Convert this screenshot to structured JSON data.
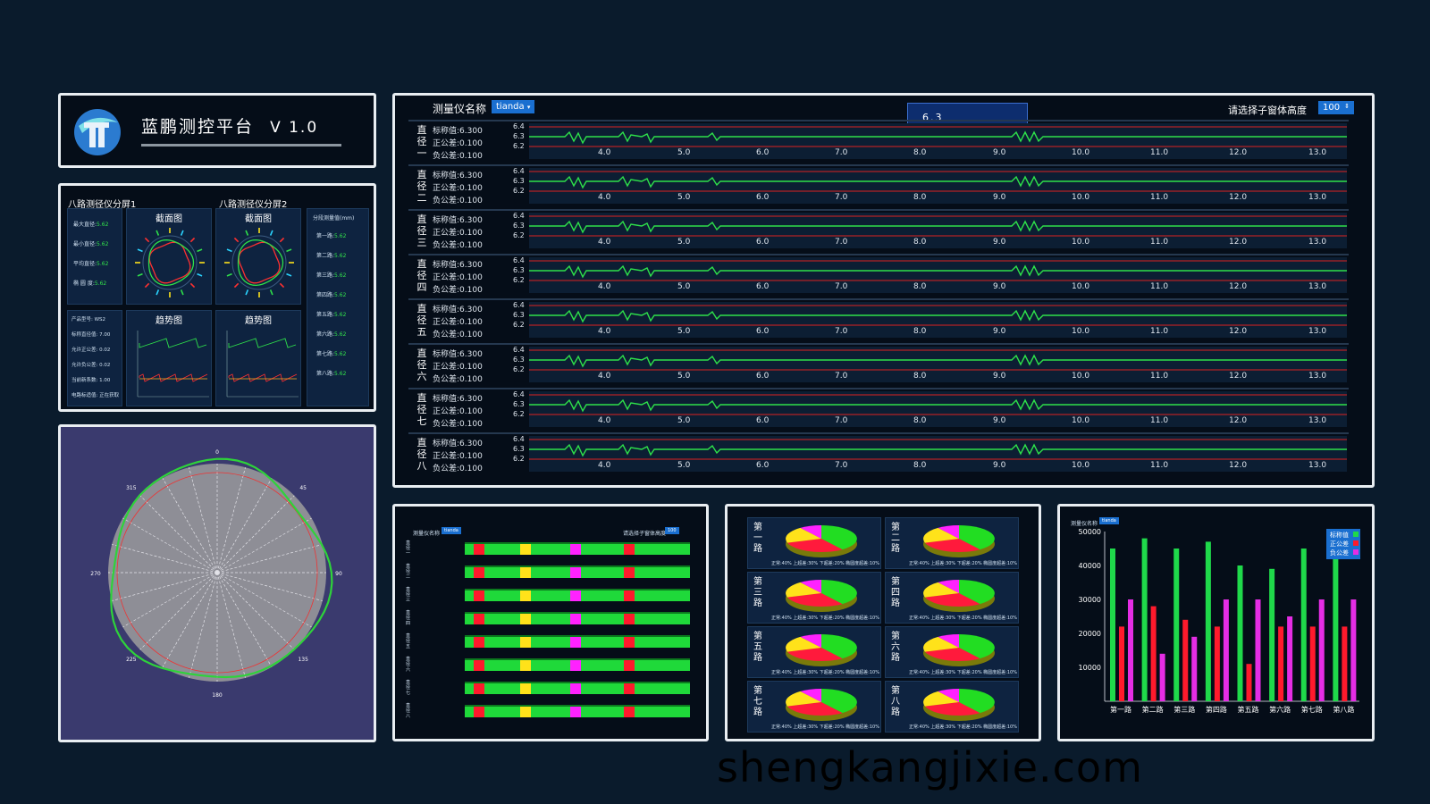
{
  "header": {
    "title": "蓝鹏测控平台",
    "version": "V 1.0"
  },
  "eight_channel": {
    "screen1_title": "八路测径仪分屏1",
    "screen2_title": "八路测径仪分屏2",
    "section_label": "截面图",
    "trend_label": "趋势图",
    "stats": [
      {
        "label": "最大直径:",
        "value": "5.62"
      },
      {
        "label": "最小直径:",
        "value": "5.62"
      },
      {
        "label": "平均直径:",
        "value": "5.62"
      },
      {
        "label": "椭 圆 度:",
        "value": "5.62"
      }
    ],
    "product_info": [
      "产品型号: WS2",
      "标称直径值: 7.00",
      "允许正公差: 0.02",
      "允许负公差: 0.02",
      "当前新系数: 1.00",
      "电路标适值: 正在获取"
    ],
    "measure_title": "分段测量值(mm)",
    "measures": [
      {
        "label": "第一路:",
        "value": "5.62"
      },
      {
        "label": "第二路:",
        "value": "5.62"
      },
      {
        "label": "第三路:",
        "value": "5.62"
      },
      {
        "label": "第四路:",
        "value": "5.62"
      },
      {
        "label": "第五路:",
        "value": "5.62"
      },
      {
        "label": "第六路:",
        "value": "5.62"
      },
      {
        "label": "第七路:",
        "value": "5.62"
      },
      {
        "label": "第八路:",
        "value": "5.62"
      }
    ]
  },
  "polar": {
    "angle_labels": [
      "0",
      "45",
      "90",
      "135",
      "180",
      "225",
      "270",
      "315"
    ]
  },
  "main": {
    "instrument_label": "测量仪名称",
    "instrument_value": "tianda",
    "height_label": "请选择子窗体高度",
    "height_value": "100",
    "popup_value": "6.3",
    "y_ticks": [
      "6.4",
      "6.3",
      "6.2"
    ],
    "x_ticks": [
      "4.0",
      "5.0",
      "6.0",
      "7.0",
      "8.0",
      "9.0",
      "10.0",
      "11.0",
      "12.0",
      "13.0"
    ],
    "rows": [
      {
        "name": "直径一",
        "nominal": "标称值:6.300",
        "plus": "正公差:0.100",
        "minus": "负公差:0.100"
      },
      {
        "name": "直径二",
        "nominal": "标称值:6.300",
        "plus": "正公差:0.100",
        "minus": "负公差:0.100"
      },
      {
        "name": "直径三",
        "nominal": "标称值:6.300",
        "plus": "正公差:0.100",
        "minus": "负公差:0.100"
      },
      {
        "name": "直径四",
        "nominal": "标称值:6.300",
        "plus": "正公差:0.100",
        "minus": "负公差:0.100"
      },
      {
        "name": "直径五",
        "nominal": "标称值:6.300",
        "plus": "正公差:0.100",
        "minus": "负公差:0.100"
      },
      {
        "name": "直径六",
        "nominal": "标称值:6.300",
        "plus": "正公差:0.100",
        "minus": "负公差:0.100"
      },
      {
        "name": "直径七",
        "nominal": "标称值:6.300",
        "plus": "正公差:0.100",
        "minus": "负公差:0.100"
      },
      {
        "name": "直径八",
        "nominal": "标称值:6.300",
        "plus": "正公差:0.100",
        "minus": "负公差:0.100"
      }
    ]
  },
  "mini": {
    "instrument_label": "测量仪名称",
    "instrument_value": "tianda",
    "height_label": "请选择子窗体高度",
    "height_value": "100",
    "rows": [
      "直径一",
      "直径二",
      "直径三",
      "直径四",
      "直径五",
      "直径六",
      "直径七",
      "直径八"
    ]
  },
  "pies": {
    "items": [
      "第一路",
      "第二路",
      "第三路",
      "第四路",
      "第五路",
      "第六路",
      "第七路",
      "第八路"
    ],
    "legend": "正常:40% 上超差:30% 下超差:20% 椭圆度超差:10%",
    "colors": {
      "normal": "#22dd22",
      "upper": "#ff1a3c",
      "lower": "#ffe21a",
      "ellipse": "#ff22ff"
    }
  },
  "bars": {
    "instrument_label": "测量仪名称",
    "instrument_value": "tianda",
    "legend": [
      "标称值",
      "正公差",
      "负公差"
    ],
    "colors": [
      "#1fd94a",
      "#ff1a2c",
      "#e52de5"
    ]
  },
  "chart_data": {
    "type": "bar",
    "categories": [
      "第一路",
      "第二路",
      "第三路",
      "第四路",
      "第五路",
      "第六路",
      "第七路",
      "第八路"
    ],
    "series": [
      {
        "name": "标称值",
        "values": [
          45000,
          48000,
          45000,
          47000,
          40000,
          39000,
          45000,
          45000
        ]
      },
      {
        "name": "正公差",
        "values": [
          22000,
          28000,
          24000,
          22000,
          11000,
          22000,
          22000,
          22000
        ]
      },
      {
        "name": "负公差",
        "values": [
          30000,
          14000,
          19000,
          30000,
          30000,
          25000,
          30000,
          30000
        ]
      }
    ],
    "ylim": [
      0,
      50000
    ],
    "y_ticks": [
      "10000",
      "20000",
      "30000",
      "40000",
      "50000"
    ]
  },
  "watermark": "shengkangjixie.com"
}
